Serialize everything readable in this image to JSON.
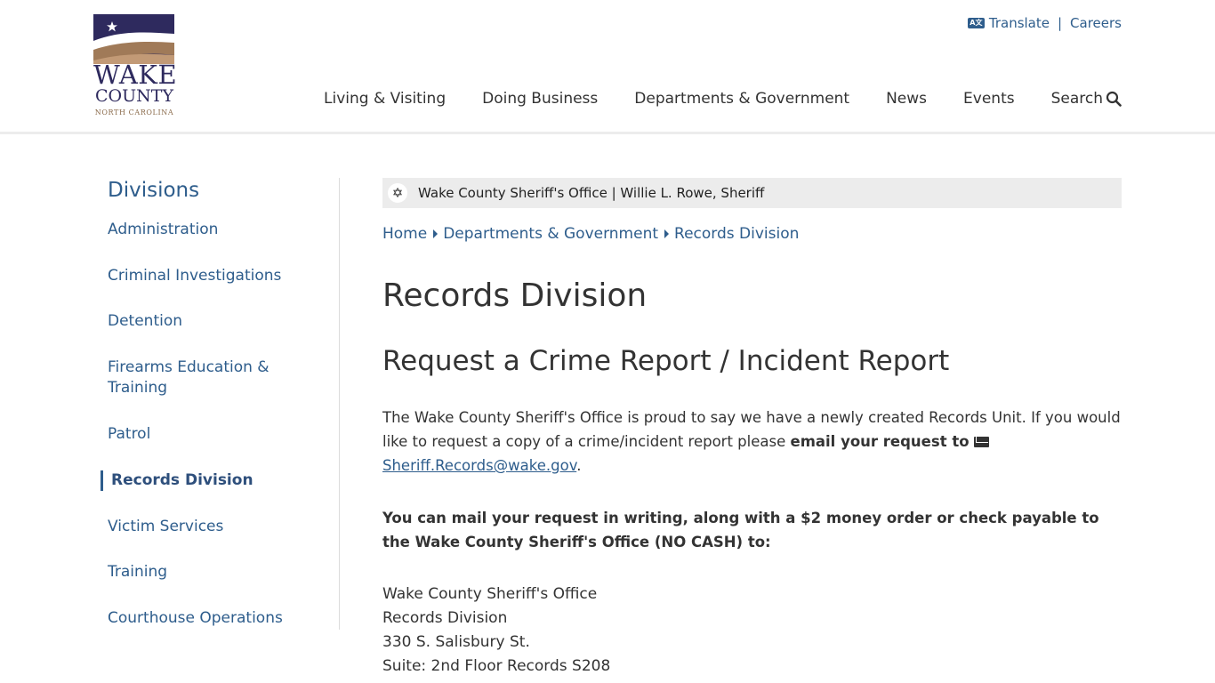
{
  "logo": {
    "line1": "WAKE",
    "line2": "COUNTY",
    "line3": "NORTH CAROLINA",
    "colors": {
      "navy": "#2e2a5e",
      "tan": "#a07a58"
    }
  },
  "utility": {
    "translate": "Translate",
    "separator": "|",
    "careers": "Careers"
  },
  "nav": [
    "Living & Visiting",
    "Doing Business",
    "Departments & Government",
    "News",
    "Events",
    "Search"
  ],
  "sidebar": {
    "title": "Divisions",
    "items": [
      "Administration",
      "Criminal Investigations",
      "Detention",
      "Firearms Education & Training",
      "Patrol",
      "Records Division",
      "Victim Services",
      "Training",
      "Courthouse Operations"
    ],
    "active": "Records Division"
  },
  "banner": {
    "text": "Wake County Sheriff's Office | Willie L. Rowe, Sheriff",
    "icon": "sheriff-star-icon"
  },
  "breadcrumb": [
    "Home",
    "Departments & Government",
    "Records Division"
  ],
  "page": {
    "title": "Records Division",
    "subtitle": "Request a Crime Report / Incident Report",
    "p1_text": "The Wake County Sheriff's Office is proud to say we have a newly created Records Unit. If you would like to request a copy of a crime/incident report please ",
    "p1_bold": "email your request to",
    "p1_email": "Sheriff.Records@wake.gov",
    "p1_end": ".",
    "p2": "You can mail your request in writing, along with a $2 money order or check payable to the Wake County Sheriff's Office (NO CASH) to:",
    "address": [
      "Wake County Sheriff's Office",
      "Records Division",
      "330 S. Salisbury St.",
      "Suite: 2nd Floor Records S208"
    ]
  },
  "colors": {
    "link": "#2e5d8c",
    "banner_bg": "#ececec"
  }
}
